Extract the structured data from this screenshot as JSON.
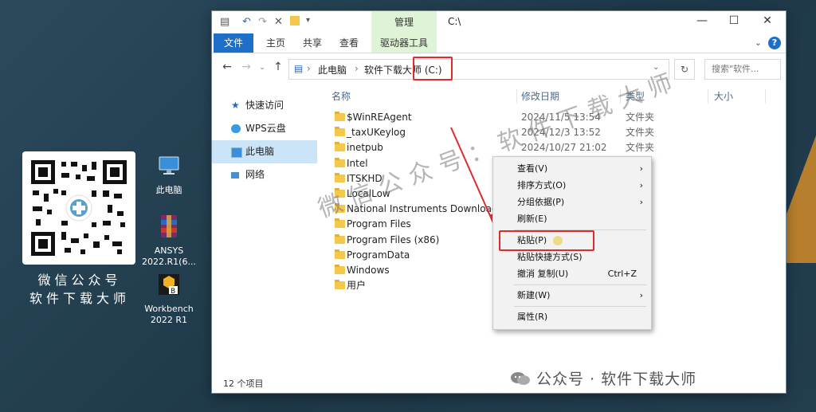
{
  "desktop": {
    "promo_line1": "微信公众号",
    "promo_line2": "软件下载大师",
    "icons": [
      {
        "name": "this-pc",
        "label": "此电脑"
      },
      {
        "name": "ansys",
        "label": "ANSYS 2022.R1(6..."
      },
      {
        "name": "workbench",
        "label": "Workbench 2022 R1"
      }
    ]
  },
  "window": {
    "title": "C:\\",
    "manage_tab": "管理",
    "controls": {
      "minimize": "—",
      "maximize": "☐",
      "close": "✕"
    },
    "ribbon_tabs": [
      "文件",
      "主页",
      "共享",
      "查看",
      "驱动器工具"
    ],
    "help": "?"
  },
  "address": {
    "crumbs": [
      "此电脑",
      "软件下载大师 (C:)"
    ],
    "search_placeholder": "搜索\"软件..."
  },
  "sidebar": {
    "items": [
      "快速访问",
      "WPS云盘",
      "此电脑",
      "网络"
    ],
    "selected": "此电脑"
  },
  "columns": [
    "名称",
    "修改日期",
    "类型",
    "大小"
  ],
  "files": [
    {
      "name": "$WinREAgent",
      "date": "2024/11/5 13:54",
      "type": "文件夹"
    },
    {
      "name": "_taxUKeylog",
      "date": "2024/12/3 13:52",
      "type": "文件夹"
    },
    {
      "name": "inetpub",
      "date": "2024/10/27 21:02",
      "type": "文件夹"
    },
    {
      "name": "Intel",
      "date": "",
      "type": ""
    },
    {
      "name": "ITSKHD",
      "date": "",
      "type": ""
    },
    {
      "name": "LocalLow",
      "date": "",
      "type": ""
    },
    {
      "name": "National Instruments Downloads",
      "date": "",
      "type": ""
    },
    {
      "name": "Program Files",
      "date": "",
      "type": ""
    },
    {
      "name": "Program Files (x86)",
      "date": "",
      "type": ""
    },
    {
      "name": "ProgramData",
      "date": "",
      "type": ""
    },
    {
      "name": "Windows",
      "date": "",
      "type": ""
    },
    {
      "name": "用户",
      "date": "",
      "type": ""
    }
  ],
  "status": "12 个项目",
  "context_menu": {
    "items": [
      {
        "label": "查看(V)",
        "submenu": true
      },
      {
        "label": "排序方式(O)",
        "submenu": true
      },
      {
        "label": "分组依据(P)",
        "submenu": true
      },
      {
        "label": "刷新(E)"
      },
      {
        "label": "粘贴(P)",
        "highlighted": true
      },
      {
        "label": "粘贴快捷方式(S)"
      },
      {
        "label": "撤消 复制(U)",
        "shortcut": "Ctrl+Z"
      },
      {
        "label": "新建(W)",
        "submenu": true
      },
      {
        "label": "属性(R)"
      }
    ]
  },
  "overlay": {
    "diagonal_watermark": "微信公众号：软件下载大师",
    "bottom_watermark": "公众号 · 软件下载大师",
    "highlight_color": "#e02b2b"
  }
}
